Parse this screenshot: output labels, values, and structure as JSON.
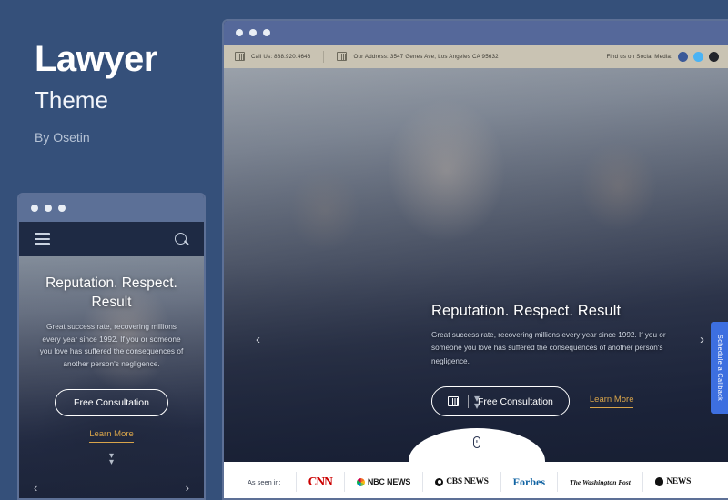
{
  "promo": {
    "title": "Lawyer",
    "subtitle": "Theme",
    "byline": "By Osetin"
  },
  "colors": {
    "page_background": "#35507a",
    "chrome_bar": "#55689a",
    "topbar_bar": "#c9c3b3",
    "mobile_nav": "#1e2a44",
    "accent_gold": "#d8a44a",
    "callback_blue": "#3d6fe0",
    "cnn_red": "#cc0000",
    "forbes_blue": "#1264a3",
    "facebook_blue": "#3b5998",
    "twitter_blue": "#4ab3f4"
  },
  "mobile": {
    "window_dots": [
      "dot",
      "dot",
      "dot"
    ],
    "nav": {
      "menu_icon": "hamburger-icon",
      "search_icon": "search-icon"
    },
    "hero": {
      "heading": "Reputation. Respect. Result",
      "paragraph": "Great success rate, recovering millions every year since 1992. If you or someone you love has suffered the consequences of another person's negligence.",
      "primary_button": "Free Consultation",
      "secondary_link": "Learn More",
      "scroll_icon": "chevron-double-down-icon",
      "prev_arrow": "‹",
      "next_arrow": "›"
    }
  },
  "desktop": {
    "window_dots": [
      "dot",
      "dot",
      "dot"
    ],
    "topbar": {
      "phone_icon": "phone-book-icon",
      "phone": "Call Us: 888.920.4646",
      "address_icon": "map-icon",
      "address": "Our Address: 3547 Genes Ave, Los Angeles CA 95632",
      "social_label": "Find us on Social Media:",
      "social_icons": [
        "facebook-icon",
        "twitter-icon",
        "instagram-icon"
      ]
    },
    "hero": {
      "heading": "Reputation. Respect. Result",
      "paragraph": "Great success rate, recovering millions every year since 1992. If you or someone you love has suffered the consequences of another person's negligence.",
      "primary_button": "Free Consultation",
      "primary_button_icon": "book-icon",
      "secondary_link": "Learn More",
      "prev_arrow": "‹",
      "next_arrow": "›",
      "callback_tab": "Schedule a Callback",
      "scroll_icon": "chevron-double-down-icon",
      "mouse_icon": "mouse-scroll-icon"
    },
    "press": {
      "label": "As seen in:",
      "logos": [
        {
          "name": "CNN",
          "icon": "cnn-logo"
        },
        {
          "name": "NBC NEWS",
          "icon": "nbc-peacock-icon"
        },
        {
          "name": "CBS NEWS",
          "icon": "cbs-eye-icon"
        },
        {
          "name": "Forbes",
          "icon": "forbes-logo"
        },
        {
          "name": "The Washington Post",
          "icon": "washington-post-logo"
        },
        {
          "name": "NEWS",
          "icon": "abc-logo"
        }
      ]
    }
  }
}
